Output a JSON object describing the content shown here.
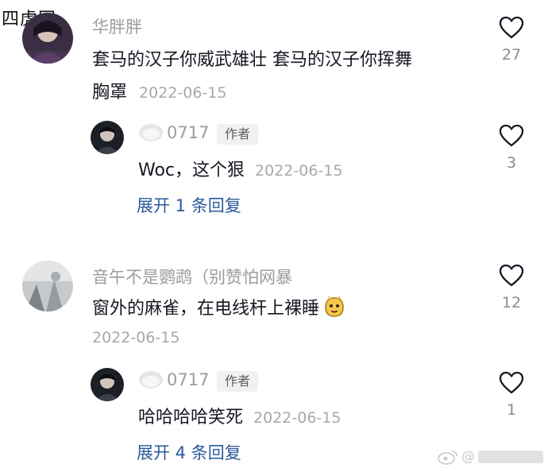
{
  "watermark_top": "四虎网",
  "watermark_bottom": "@",
  "comments": [
    {
      "username": "华胖胖",
      "line1": "套马的汉子你威武雄壮 套马的汉子你挥舞",
      "line2": "胸罩",
      "date": "2022-06-15",
      "likes": "27",
      "reply": {
        "username": "0717",
        "badge": "作者",
        "text": "Woc，这个狠",
        "date": "2022-06-15",
        "likes": "3"
      },
      "expand": "展开 1 条回复"
    },
    {
      "username": "音午不是鹦鹉（别赞怕网暴",
      "line1": "窗外的麻雀，在电线杆上裸睡",
      "date": "2022-06-15",
      "likes": "12",
      "reply": {
        "username": "0717",
        "badge": "作者",
        "text": "哈哈哈哈笑死",
        "date": "2022-06-15",
        "likes": "1"
      },
      "expand": "展开 4 条回复"
    }
  ],
  "colors": {
    "text": "#161823",
    "muted": "#9b9ca1",
    "link": "#2b5a9b"
  }
}
